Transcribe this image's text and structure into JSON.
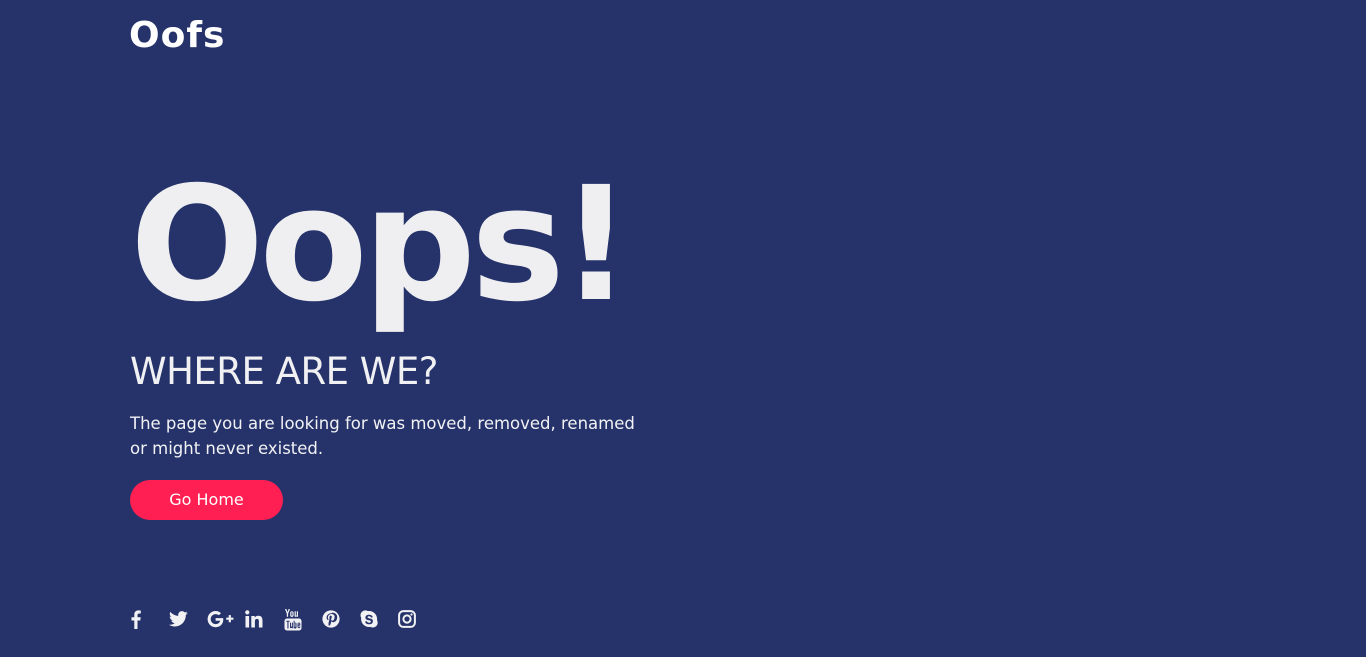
{
  "header": {
    "logo_text": "Oofs"
  },
  "main": {
    "headline": "Oops!",
    "subheadline": "WHERE ARE WE?",
    "description": "The page you are looking for was moved, removed, renamed or might never existed.",
    "home_button_label": "Go Home"
  },
  "footer": {
    "social_links": [
      {
        "icon": "facebook-icon"
      },
      {
        "icon": "twitter-icon"
      },
      {
        "icon": "google-plus-icon"
      },
      {
        "icon": "linkedin-icon"
      },
      {
        "icon": "youtube-icon"
      },
      {
        "icon": "pinterest-icon"
      },
      {
        "icon": "skype-icon"
      },
      {
        "icon": "instagram-icon"
      }
    ]
  },
  "colors": {
    "background": "#25336a",
    "accent": "#ff1f52",
    "text": "#f0f0f2"
  }
}
